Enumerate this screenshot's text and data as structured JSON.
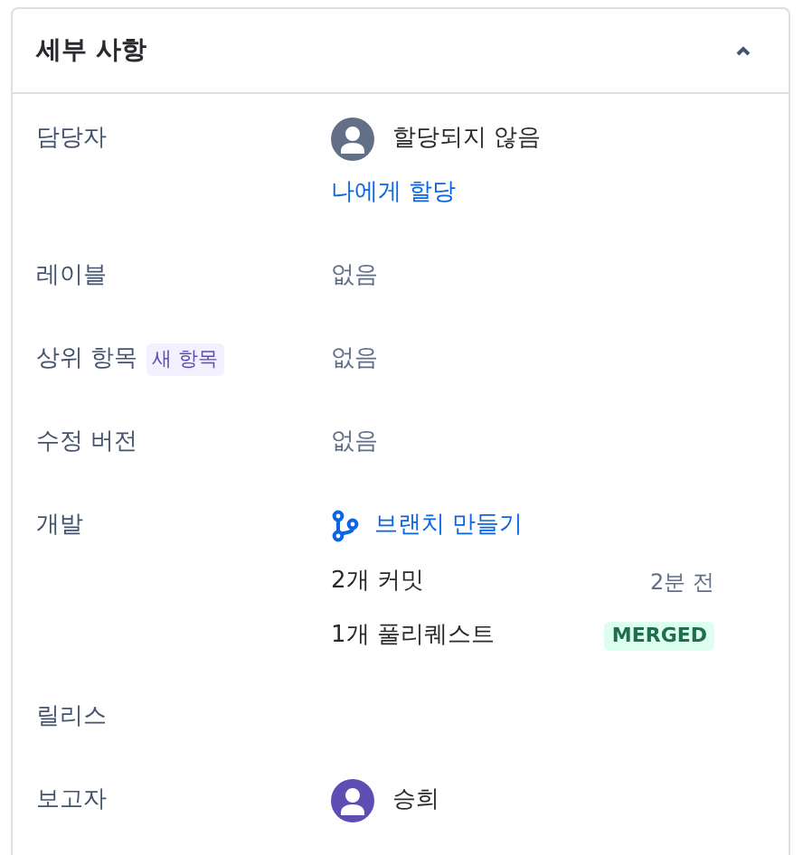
{
  "panel": {
    "title": "세부 사항",
    "expanded": true
  },
  "fields": [
    {
      "kind": "person",
      "label": "담당자",
      "name": "할당되지 않음",
      "color": "#626f86",
      "action": "나에게 할당"
    },
    {
      "kind": "text",
      "label": "레이블",
      "value": "없음"
    },
    {
      "kind": "text",
      "label": "상위 항목",
      "badge": "새 항목",
      "value": "없음"
    },
    {
      "kind": "text",
      "label": "수정 버전",
      "value": "없음"
    },
    {
      "kind": "development",
      "label": "개발",
      "action": "브랜치 만들기",
      "items": [
        {
          "text": "2개 커밋",
          "meta": "2분 전"
        },
        {
          "text": "1개 풀리퀘스트",
          "status": "MERGED"
        }
      ]
    },
    {
      "kind": "empty",
      "label": "릴리스"
    },
    {
      "kind": "person",
      "label": "보고자",
      "name": "승희",
      "color": "#5e4db2"
    }
  ]
}
